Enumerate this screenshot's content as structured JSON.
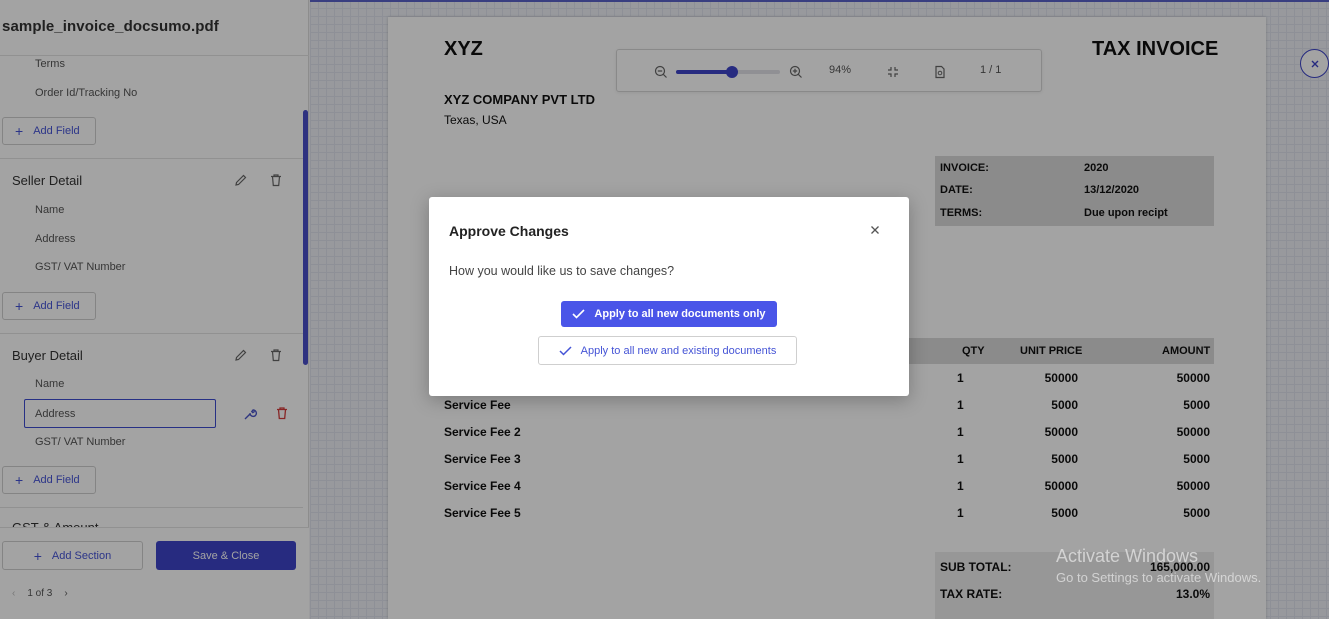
{
  "sidebar": {
    "doc_title": "sample_invoice_docsumo.pdf",
    "top_fields": [
      "Terms",
      "Order Id/Tracking No"
    ],
    "add_field_label": "Add Field",
    "sections": [
      {
        "title": "Seller Detail",
        "fields": [
          "Name",
          "Address",
          "GST/ VAT Number"
        ]
      },
      {
        "title": "Buyer Detail",
        "fields": [
          "Name",
          "Address",
          "GST/ VAT Number"
        ]
      }
    ],
    "partial_section_title": "GST & Amount",
    "add_section_label": "Add Section",
    "save_close_label": "Save & Close",
    "pager_text": "1 of 3"
  },
  "toolbar": {
    "zoom_level": "94%",
    "zoom_slider_fraction": 0.54,
    "page_indicator": "1 / 1"
  },
  "invoice": {
    "brand": "XYZ",
    "doc_type": "TAX INVOICE",
    "company": "XYZ COMPANY PVT LTD",
    "location": "Texas, USA",
    "info": [
      {
        "label": "INVOICE:",
        "value": "2020"
      },
      {
        "label": "DATE:",
        "value": "13/12/2020"
      },
      {
        "label": "TERMS:",
        "value": "Due upon recipt"
      }
    ],
    "columns": [
      "QTY",
      "UNIT PRICE",
      "AMOUNT"
    ],
    "rows": [
      {
        "desc": "",
        "qty": "1",
        "price": "50000",
        "amount": "50000"
      },
      {
        "desc": "Service Fee",
        "qty": "1",
        "price": "5000",
        "amount": "5000"
      },
      {
        "desc": "Service Fee 2",
        "qty": "1",
        "price": "50000",
        "amount": "50000"
      },
      {
        "desc": "Service Fee 3",
        "qty": "1",
        "price": "5000",
        "amount": "5000"
      },
      {
        "desc": "Service Fee 4",
        "qty": "1",
        "price": "50000",
        "amount": "50000"
      },
      {
        "desc": "Service Fee 5",
        "qty": "1",
        "price": "5000",
        "amount": "5000"
      }
    ],
    "summary": [
      {
        "label": "SUB TOTAL:",
        "value": "165,000.00"
      },
      {
        "label": "TAX RATE:",
        "value": "13.0%"
      }
    ]
  },
  "modal": {
    "title": "Approve Changes",
    "question": "How you would like us to save changes?",
    "primary_label": "Apply to all new documents only",
    "secondary_label": "Apply to all new and existing documents"
  },
  "watermark": {
    "line1": "Activate Windows",
    "line2": "Go to Settings to activate Windows."
  },
  "colors": {
    "accent": "#3d44c8",
    "primary_button": "#4a55e8",
    "danger": "#d43a3a"
  }
}
